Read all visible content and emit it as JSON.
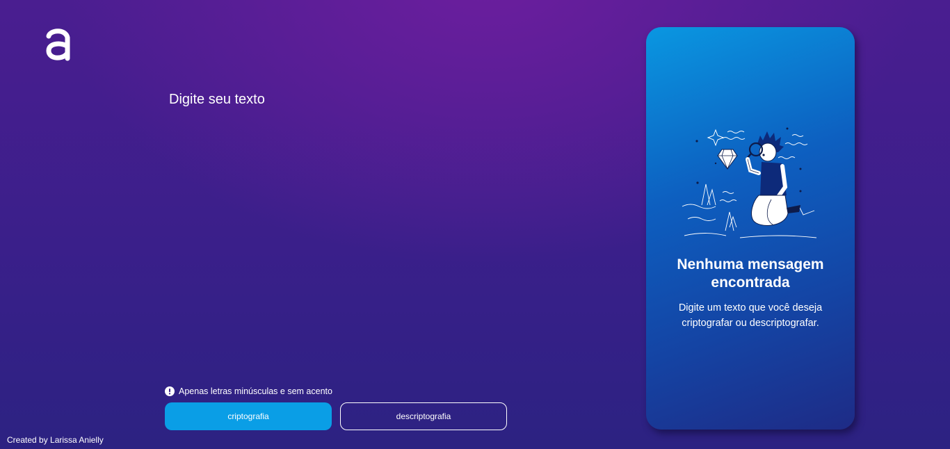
{
  "logo": {
    "icon": "alura-a-logo-icon"
  },
  "editor": {
    "placeholder": "Digite seu texto",
    "value": ""
  },
  "hint": {
    "icon": "exclamation-circle-icon",
    "text": "Apenas letras minúsculas e sem acento"
  },
  "buttons": {
    "encrypt_label": "criptografia",
    "decrypt_label": "descriptografia"
  },
  "output_card": {
    "illustration": "person-with-magnifying-glass-illustration",
    "title": "Nenhuma mensagem encontrada",
    "text": "Digite um texto que você deseja criptografar ou descriptografar."
  },
  "footer": {
    "credit": "Created by Larissa Anielly"
  },
  "colors": {
    "background_top": "#6c1e9e",
    "background_bottom": "#2c2282",
    "primary_button": "#0a9ee6",
    "card_top": "#0a97e1",
    "card_bottom": "#1e2b86"
  }
}
